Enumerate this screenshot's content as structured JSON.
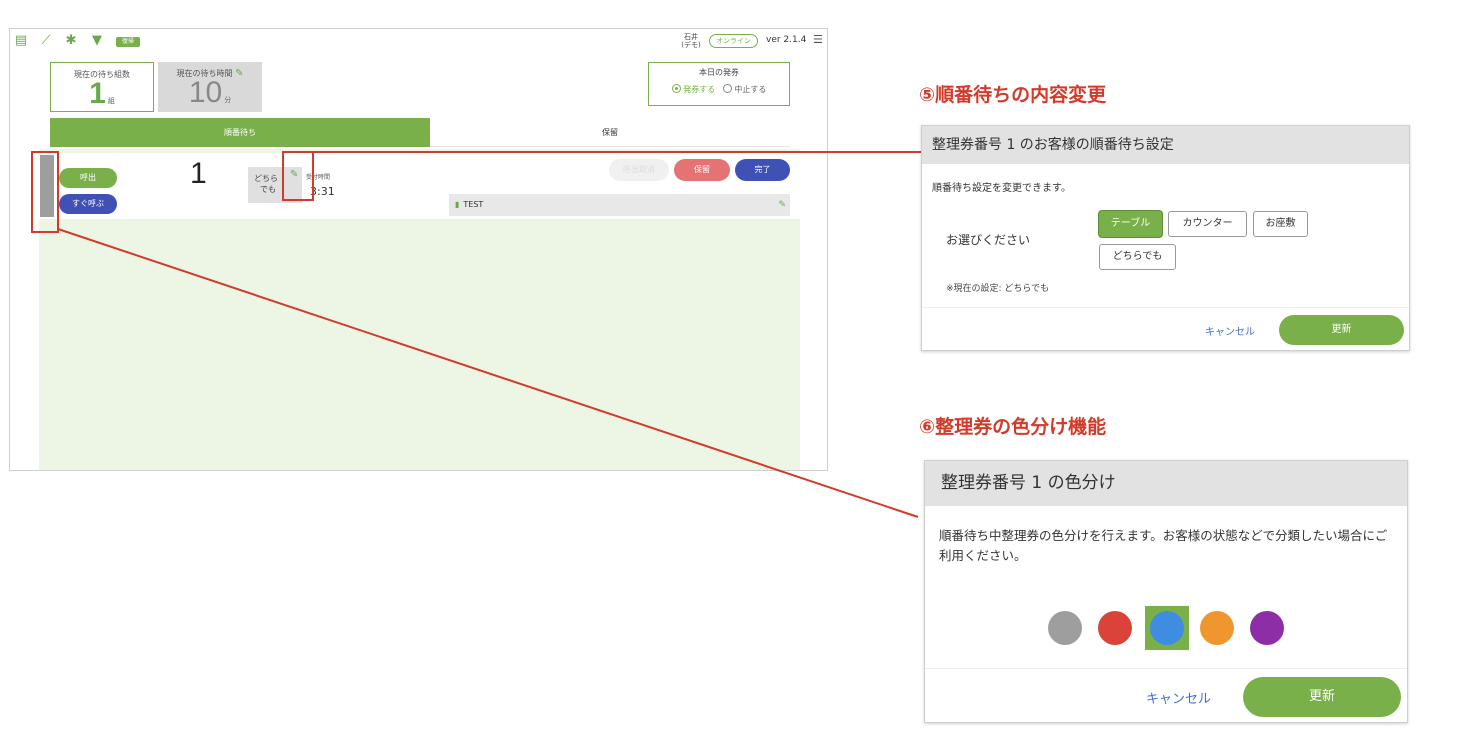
{
  "app": {
    "topbar": {
      "icons": [
        "store-icon",
        "chart-icon",
        "gear-icon",
        "filter-icon"
      ],
      "badge": "復帰",
      "user_name": "石井",
      "user_sub": "(デモ)",
      "status": "オンライン",
      "version": "ver 2.1.4"
    },
    "stats": {
      "groups_label": "現在の待ち組数",
      "groups_value": "1",
      "groups_unit": "組",
      "time_label": "現在の待ち時間",
      "time_value": "10",
      "time_unit": "分"
    },
    "issue": {
      "label": "本日の発券",
      "opt_on": "発券する",
      "opt_off": "中止する"
    },
    "tabs": {
      "wait": "順番待ち",
      "hold": "保留"
    },
    "card": {
      "call": "呼出",
      "call_now": "すぐ呼ぶ",
      "ticket_number": "1",
      "seat_line1": "どちら",
      "seat_line2": "でも",
      "received_label": "受付時間",
      "received_time": "3:31",
      "ghost_btn": "呼出取消",
      "hold_btn": "保留",
      "done_btn": "完了",
      "memo": "TEST"
    }
  },
  "panel1": {
    "section_title": "⑤順番待ちの内容変更",
    "header": "整理券番号 1 のお客様の順番待ち設定",
    "desc": "順番待ち設定を変更できます。",
    "choose_label": "お選びください",
    "options": [
      "テーブル",
      "カウンター",
      "お座敷",
      "どちらでも"
    ],
    "selected": "テーブル",
    "current": "※現在の設定: どちらでも",
    "cancel": "キャンセル",
    "update": "更新"
  },
  "panel2": {
    "section_title": "⑥整理券の色分け機能",
    "header": "整理券番号 1 の色分け",
    "desc": "順番待ち中整理券の色分けを行えます。お客様の状態などで分類したい場合にご利用ください。",
    "colors": [
      "#9e9e9e",
      "#d9433a",
      "#3f8de0",
      "#f0962e",
      "#8e2ea6"
    ],
    "selected_color": "#3f8de0",
    "cancel": "キャンセル",
    "update": "更新"
  }
}
